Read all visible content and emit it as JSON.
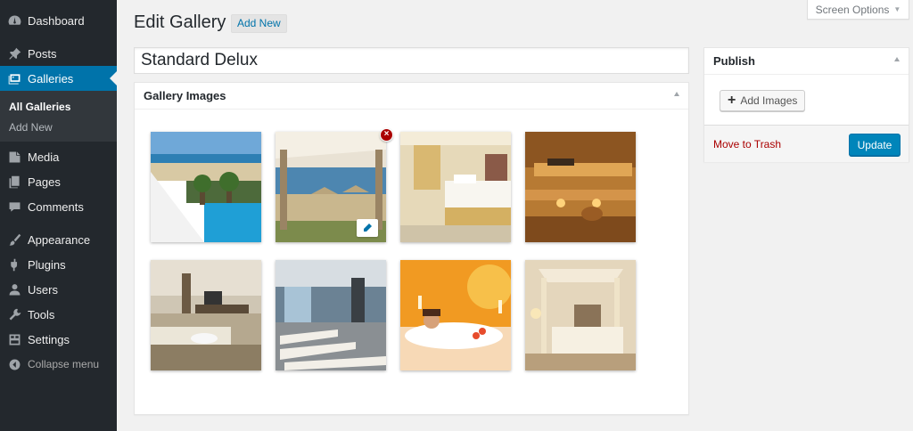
{
  "sidebar": {
    "items": [
      {
        "label": "Dashboard",
        "icon": "dashboard-icon"
      },
      {
        "label": "Posts",
        "icon": "pin-icon"
      },
      {
        "label": "Galleries",
        "icon": "gallery-icon"
      },
      {
        "label": "Media",
        "icon": "media-icon"
      },
      {
        "label": "Pages",
        "icon": "pages-icon"
      },
      {
        "label": "Comments",
        "icon": "comments-icon"
      },
      {
        "label": "Appearance",
        "icon": "brush-icon"
      },
      {
        "label": "Plugins",
        "icon": "plugin-icon"
      },
      {
        "label": "Users",
        "icon": "users-icon"
      },
      {
        "label": "Tools",
        "icon": "wrench-icon"
      },
      {
        "label": "Settings",
        "icon": "settings-icon"
      }
    ],
    "submenu": [
      "All Galleries",
      "Add New"
    ],
    "collapse_label": "Collapse menu"
  },
  "screen_options": "Screen Options",
  "header": {
    "title": "Edit Gallery",
    "add_new": "Add New"
  },
  "title_value": "Standard Delux",
  "gallery_box": {
    "title": "Gallery Images",
    "images": [
      "beach-pool",
      "beach-cabana",
      "hotel-bedroom",
      "sauna",
      "living-room",
      "spa-loungers",
      "bubble-bath",
      "canopy-bedroom"
    ]
  },
  "publish": {
    "title": "Publish",
    "add_images": "Add Images",
    "trash": "Move to Trash",
    "update": "Update"
  },
  "colors": {
    "accent": "#0073aa",
    "sidebar": "#23282d",
    "delete": "#aa0000",
    "update": "#0085ba"
  }
}
